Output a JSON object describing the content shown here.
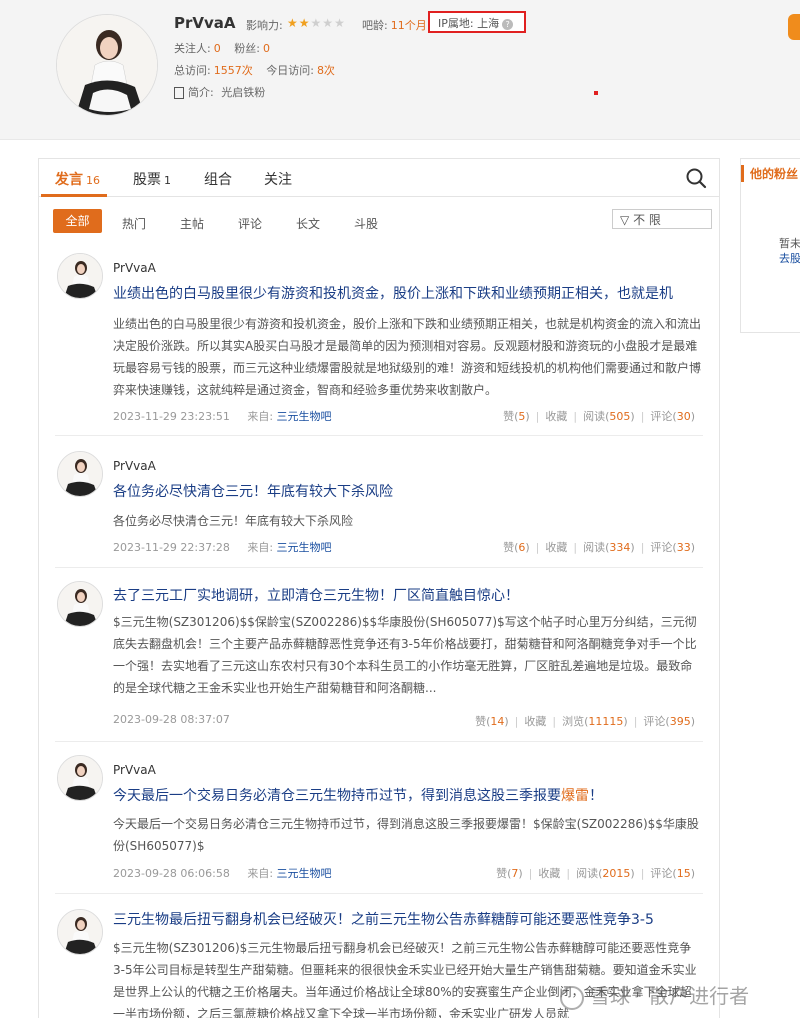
{
  "profile": {
    "username": "PrVvaA",
    "influence_label": "影响力:",
    "influence_stars": 2,
    "influence_max": 5,
    "bar_age_label": "吧龄:",
    "bar_age": "11个月",
    "ip_label": "IP属地: 上海",
    "following_label": "关注人:",
    "following": "0",
    "fans_label": "粉丝:",
    "fans": "0",
    "total_visits_label": "总访问:",
    "total_visits": "1557次",
    "today_visits_label": "今日访问:",
    "today_visits": "8次",
    "bio_label": "简介:",
    "bio": "光启铁粉"
  },
  "tabs": [
    {
      "label": "发言",
      "count": "16"
    },
    {
      "label": "股票",
      "count": "1"
    },
    {
      "label": "组合",
      "count": ""
    },
    {
      "label": "关注",
      "count": ""
    }
  ],
  "filters": [
    "全部",
    "热门",
    "主帖",
    "评论",
    "长文",
    "斗股"
  ],
  "filter_limit": "不 限",
  "posts": [
    {
      "name": "PrVvaA",
      "title": "业绩出色的白马股里很少有游资和投机资金，股价上涨和下跌和业绩预期正相关，也就是机",
      "body": "业绩出色的白马股里很少有游资和投机资金，股价上涨和下跌和业绩预期正相关，也就是机构资金的流入和流出决定股价涨跌。所以其实A股买白马股才是最简单的因为预测相对容易。反观题材股和游资玩的小盘股才是最难玩最容易亏钱的股票，而三元这种业绩爆雷股就是地狱级别的难！游资和短线投机的机构他们需要通过和散户博弈来快速赚钱，这就纯粹是通过资金，智商和经验多重优势来收割散户。",
      "time": "2023-11-29 23:23:51",
      "from_label": "来自:",
      "source": "三元生物吧",
      "likes_label": "赞",
      "likes": "5",
      "fav_label": "收藏",
      "read_label": "阅读",
      "reads": "505",
      "comment_label": "评论",
      "comments": "30"
    },
    {
      "name": "PrVvaA",
      "title": "各位务必尽快清仓三元！年底有较大下杀风险",
      "body": "各位务必尽快清仓三元！年底有较大下杀风险",
      "time": "2023-11-29 22:37:28",
      "from_label": "来自:",
      "source": "三元生物吧",
      "likes_label": "赞",
      "likes": "6",
      "fav_label": "收藏",
      "read_label": "阅读",
      "reads": "334",
      "comment_label": "评论",
      "comments": "33"
    },
    {
      "name": "",
      "title": "去了三元工厂实地调研，立即清仓三元生物！厂区简直触目惊心！",
      "body": "$三元生物(SZ301206)$$保龄宝(SZ002286)$$华康股份(SH605077)$写这个帖子时心里万分纠结，三元彻底失去翻盘机会！三个主要产品赤藓糖醇恶性竞争还有3-5年价格战要打，甜菊糖苷和阿洛酮糖竞争对手一个比一个强！去实地看了三元这山东农村只有30个本科生员工的小作坊毫无胜算，厂区脏乱差遍地是垃圾。最致命的是全球代糖之王金禾实业也开始生产甜菊糖苷和阿洛酮糖...",
      "time": "2023-09-28 08:37:07",
      "from_label": "",
      "source": "",
      "likes_label": "赞",
      "likes": "14",
      "fav_label": "收藏",
      "read_label": "浏览",
      "reads": "11115",
      "comment_label": "评论",
      "comments": "395"
    },
    {
      "name": "PrVvaA",
      "title_pre": "今天最后一个交易日务必清仓三元生物持币过节，得到消息这股三季报要",
      "title_hl": "爆雷",
      "title_post": "！",
      "body": "今天最后一个交易日务必清仓三元生物持币过节，得到消息这股三季报要爆雷！$保龄宝(SZ002286)$$华康股份(SH605077)$",
      "time": "2023-09-28 06:06:58",
      "from_label": "来自:",
      "source": "三元生物吧",
      "likes_label": "赞",
      "likes": "7",
      "fav_label": "收藏",
      "read_label": "阅读",
      "reads": "2015",
      "comment_label": "评论",
      "comments": "15"
    },
    {
      "name": "",
      "title": "三元生物最后扭亏翻身机会已经破灭！之前三元生物公告赤藓糖醇可能还要恶性竞争3-5",
      "body": "$三元生物(SZ301206)$三元生物最后扭亏翻身机会已经破灭！之前三元生物公告赤藓糖醇可能还要恶性竞争3-5年公司目标是转型生产甜菊糖。但噩耗来的很很快金禾实业已经开始大量生产销售甜菊糖。要知道金禾实业是世界上公认的代糖之王价格屠夫。当年通过价格战让全球80%的安赛蜜生产企业倒闭，金禾实业拿下全球超一半市场份额，之后三氯蔗糖价格战又拿下全球一半市场份额，金禾实业广研发人员就"
    }
  ],
  "right_panel": {
    "title": "他的粉丝",
    "line1": "暂未",
    "line2": "去股"
  },
  "watermark": "雪球 · 散户进行者"
}
